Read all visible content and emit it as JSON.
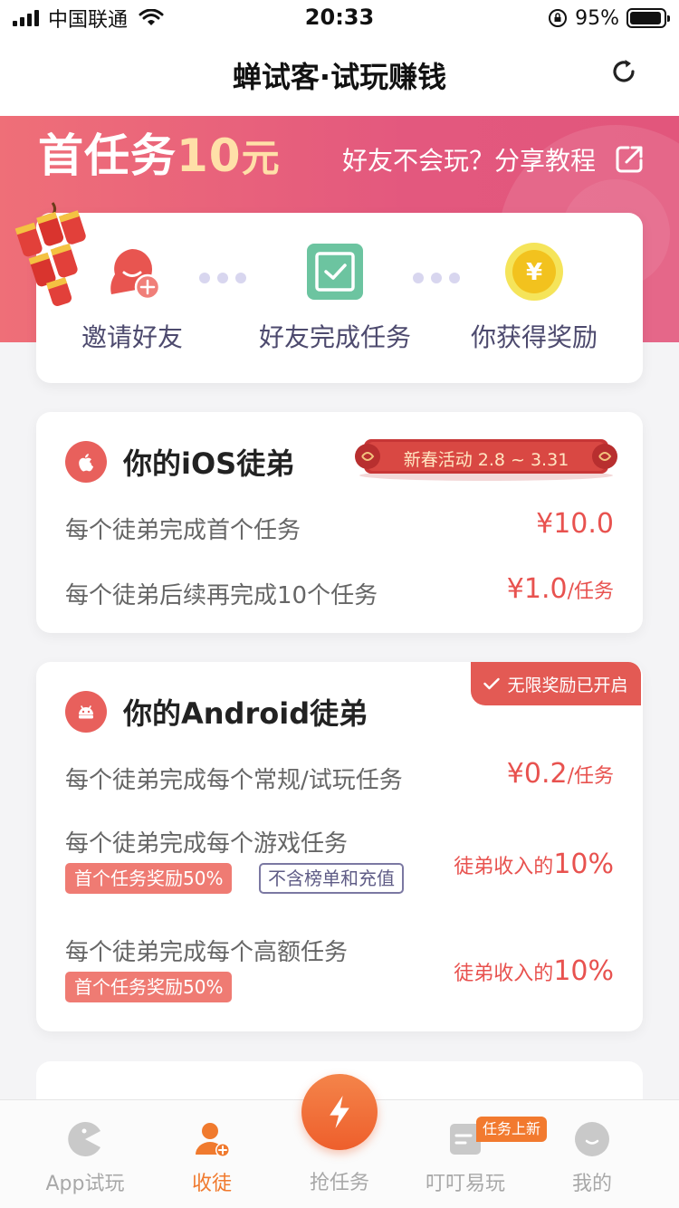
{
  "status_bar": {
    "carrier": "中国联通",
    "time": "20:33",
    "battery_percent": "95%",
    "battery_level": 0.95
  },
  "nav": {
    "title": "蝉试客·试玩赚钱",
    "refresh_icon": "refresh-icon"
  },
  "banner": {
    "title_prefix": "首任务",
    "title_amount": "10",
    "title_unit": "元",
    "share_text": "好友不会玩？分享教程",
    "share_icon": "share-icon"
  },
  "steps": [
    {
      "label": "邀请好友",
      "icon": "invite-friend-icon"
    },
    {
      "label": "好友完成任务",
      "icon": "task-check-icon"
    },
    {
      "label": "你获得奖励",
      "icon": "yen-coin-icon"
    }
  ],
  "ios_card": {
    "title": "你的iOS徒弟",
    "promo": "新春活动 2.8 ~ 3.31",
    "rows": [
      {
        "label": "每个徒弟完成首个任务",
        "value": "¥10.0",
        "unit": ""
      },
      {
        "label": "每个徒弟后续再完成10个任务",
        "value": "¥1.0",
        "unit": "/任务"
      }
    ]
  },
  "android_card": {
    "title": "你的Android徒弟",
    "badge": "无限奖励已开启",
    "rows": [
      {
        "label": "每个徒弟完成每个常规/试玩任务",
        "value": "¥0.2",
        "unit": "/任务"
      },
      {
        "label": "每个徒弟完成每个游戏任务",
        "value_prefix": "徒弟收入的",
        "value": "10%",
        "tags": [
          "首个任务奖励50%",
          "不含榜单和充值"
        ]
      },
      {
        "label": "每个徒弟完成每个高额任务",
        "value_prefix": "徒弟收入的",
        "value": "10%",
        "tags": [
          "首个任务奖励50%"
        ]
      }
    ]
  },
  "tabs": [
    {
      "label": "App试玩",
      "icon": "pacman-icon",
      "active": false
    },
    {
      "label": "收徒",
      "icon": "add-user-icon",
      "active": true
    },
    {
      "label": "抢任务",
      "icon": "lightning-icon",
      "active": false
    },
    {
      "label": "叮叮易玩",
      "icon": "doc-icon",
      "active": false,
      "badge": "任务上新"
    },
    {
      "label": "我的",
      "icon": "smile-face-icon",
      "active": false
    }
  ],
  "colors": {
    "accent": "#e8524f",
    "banner_start": "#ef6f78",
    "banner_end": "#e2567c",
    "tab_active": "#f07a2e"
  }
}
